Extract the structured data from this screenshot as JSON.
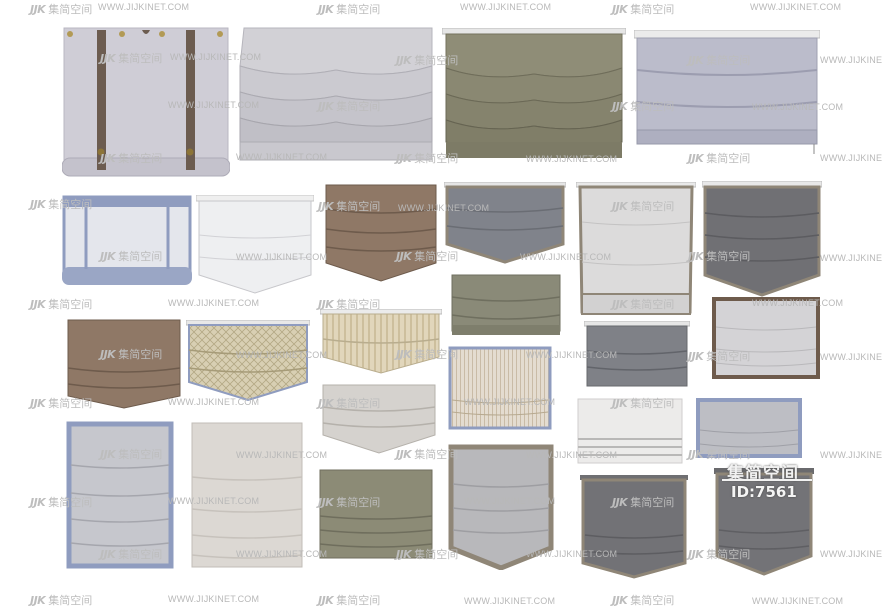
{
  "watermark": {
    "url": "WWW.JIJKINET.COM",
    "logo_latin": "JJK",
    "logo_cn": "集简空间"
  },
  "badge": {
    "title": "集简空间",
    "id": "ID:7561"
  },
  "shade_colors": {
    "lavender": "#c9c7d2",
    "gray_light": "#d6d5da",
    "olive": "#8c8a74",
    "periwinkle": "#b7b8c8",
    "white_sheer": "#ecedf0",
    "brown": "#8f7866",
    "slate": "#7c7f86",
    "linen": "#d9d6d2",
    "beige": "#d9cfb8",
    "charcoal": "#6f6f72",
    "strap": "#6c5c50",
    "blue_trim": "#8f9cbf",
    "taupe_trim": "#8f8677"
  }
}
